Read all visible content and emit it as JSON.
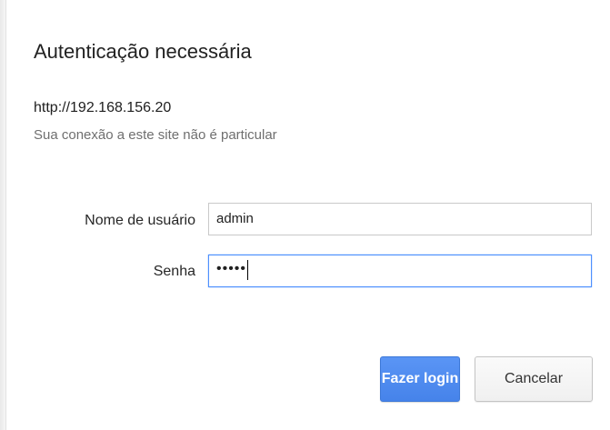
{
  "dialog": {
    "title": "Autenticação necessária",
    "url": "http://192.168.156.20",
    "privacy_note": "Sua conexão a este site não é particular"
  },
  "form": {
    "username_label": "Nome de usuário",
    "username_value": "admin",
    "password_label": "Senha",
    "password_masked": "•••••"
  },
  "buttons": {
    "login_label": "Fazer login",
    "cancel_label": "Cancelar"
  },
  "colors": {
    "accent": "#4683ea",
    "focus_border": "#4d90fe"
  }
}
